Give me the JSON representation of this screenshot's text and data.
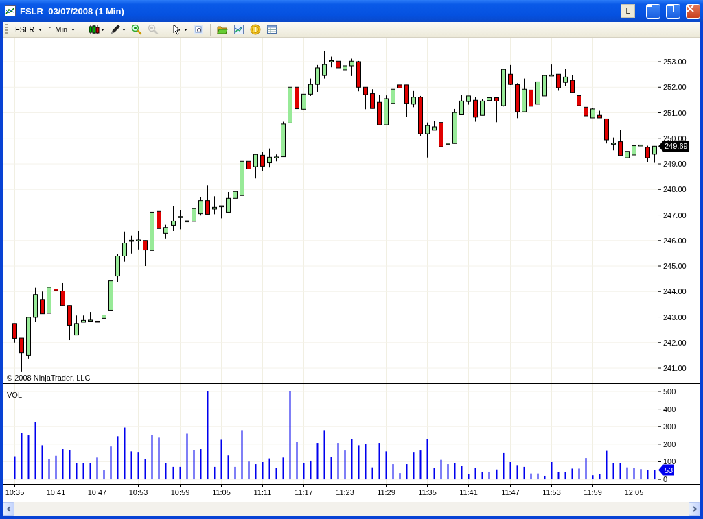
{
  "window": {
    "title": "FSLR  03/07/2008 (1 Min)",
    "link_button": "L"
  },
  "toolbar": {
    "instrument": "FSLR",
    "interval": "1 Min",
    "tool_groups": [
      [
        {
          "kind": "candles",
          "dropdown": true,
          "disabled": false
        },
        {
          "kind": "pencil",
          "dropdown": true,
          "disabled": false
        },
        {
          "kind": "zoom-in",
          "dropdown": false,
          "disabled": false
        },
        {
          "kind": "zoom-out",
          "dropdown": false,
          "disabled": true
        }
      ],
      [
        {
          "kind": "pointer",
          "dropdown": true,
          "disabled": false
        },
        {
          "kind": "properties",
          "dropdown": false,
          "disabled": false
        }
      ],
      [
        {
          "kind": "folder",
          "dropdown": false,
          "disabled": false
        },
        {
          "kind": "chart",
          "dropdown": false,
          "disabled": false
        },
        {
          "kind": "coin",
          "dropdown": false,
          "disabled": false
        },
        {
          "kind": "table",
          "dropdown": false,
          "disabled": false
        }
      ]
    ]
  },
  "price_panel": {
    "copyright": "© 2008 NinjaTrader, LLC",
    "chart_data": {
      "type": "candlestick",
      "grid": true,
      "ylim": [
        240.41,
        253.94
      ],
      "categories": [
        null,
        null,
        null,
        null,
        null,
        null,
        null,
        null,
        null,
        null,
        null,
        null,
        null,
        null,
        null,
        null,
        null,
        null,
        null,
        null,
        null,
        null,
        null,
        null,
        null,
        null,
        null,
        null,
        null,
        null,
        null,
        null,
        null,
        null,
        null,
        null,
        null,
        null,
        null,
        null,
        null,
        null,
        null,
        null,
        null,
        null,
        null,
        null,
        null,
        null,
        null,
        null,
        null,
        null,
        null,
        null,
        null,
        null,
        null,
        null,
        null,
        null,
        null,
        null,
        null,
        null,
        null,
        null,
        null,
        null,
        null,
        null,
        null,
        null,
        null,
        null,
        null,
        null,
        null,
        null,
        null,
        null,
        null,
        null,
        null,
        null,
        null,
        null,
        null,
        null,
        null,
        null,
        null,
        null
      ],
      "yticks": [
        {
          "value": 241,
          "label": "241.00"
        },
        {
          "value": 242,
          "label": "242.00"
        },
        {
          "value": 243,
          "label": "243.00"
        },
        {
          "value": 244,
          "label": "244.00"
        },
        {
          "value": 245,
          "label": "245.00"
        },
        {
          "value": 246,
          "label": "246.00"
        },
        {
          "value": 247,
          "label": "247.00"
        },
        {
          "value": 248,
          "label": "248.00"
        },
        {
          "value": 249,
          "label": "249.00"
        },
        {
          "value": 250,
          "label": "250.00"
        },
        {
          "value": 251,
          "label": "251.00"
        },
        {
          "value": 252,
          "label": "252.00"
        },
        {
          "value": 253,
          "label": "253.00"
        }
      ],
      "annotations": [
        "249.69"
      ],
      "ohlc": [
        [
          242.75,
          242.75,
          242.0,
          242.17
        ],
        [
          242.18,
          242.18,
          240.87,
          241.6
        ],
        [
          241.5,
          243.0,
          241.38,
          242.99
        ],
        [
          242.99,
          244.15,
          242.8,
          243.88
        ],
        [
          243.69,
          244.0,
          243.13,
          243.13
        ],
        [
          243.15,
          244.24,
          243.15,
          244.17
        ],
        [
          244.1,
          244.33,
          243.9,
          244.03
        ],
        [
          244.02,
          244.33,
          243.45,
          243.45
        ],
        [
          243.45,
          243.45,
          242.1,
          242.68
        ],
        [
          242.3,
          243.06,
          242.3,
          242.75
        ],
        [
          242.8,
          243.06,
          242.8,
          242.87
        ],
        [
          242.86,
          243.2,
          242.84,
          242.86
        ],
        [
          242.84,
          243.18,
          242.56,
          242.8
        ],
        [
          242.95,
          243.47,
          242.95,
          243.08
        ],
        [
          243.27,
          244.76,
          243.27,
          244.42
        ],
        [
          244.61,
          245.46,
          244.36,
          245.39
        ],
        [
          245.39,
          246.35,
          245.17,
          245.9
        ],
        [
          245.99,
          246.19,
          245.49,
          245.99
        ],
        [
          246.0,
          246.37,
          245.65,
          246.0
        ],
        [
          246.0,
          246.0,
          245.0,
          245.63
        ],
        [
          245.61,
          247.11,
          245.26,
          247.11
        ],
        [
          247.14,
          247.6,
          246.17,
          246.47
        ],
        [
          246.28,
          246.62,
          246.08,
          246.51
        ],
        [
          246.6,
          247.34,
          246.37,
          246.76
        ],
        [
          246.92,
          247.18,
          246.44,
          246.92
        ],
        [
          246.75,
          247.18,
          246.51,
          246.75
        ],
        [
          246.75,
          247.25,
          246.65,
          247.25
        ],
        [
          247.05,
          247.7,
          246.98,
          247.56
        ],
        [
          247.56,
          248.16,
          247.03,
          247.03
        ],
        [
          247.23,
          247.73,
          247.03,
          247.3
        ],
        [
          247.34,
          247.34,
          246.87,
          247.34
        ],
        [
          247.11,
          247.9,
          247.11,
          247.65
        ],
        [
          247.65,
          247.96,
          247.49,
          247.92
        ],
        [
          247.76,
          249.37,
          247.76,
          249.1
        ],
        [
          249.1,
          249.34,
          248.05,
          248.8
        ],
        [
          248.89,
          249.37,
          248.43,
          249.37
        ],
        [
          249.34,
          249.47,
          248.73,
          248.91
        ],
        [
          249.04,
          249.6,
          248.86,
          249.26
        ],
        [
          249.25,
          249.37,
          249.1,
          249.25
        ],
        [
          249.28,
          250.65,
          249.28,
          250.56
        ],
        [
          250.6,
          252.0,
          250.6,
          252.0
        ],
        [
          252.0,
          252.87,
          251.14,
          251.16
        ],
        [
          251.14,
          251.73,
          251.14,
          251.73
        ],
        [
          251.73,
          252.34,
          251.66,
          252.11
        ],
        [
          252.11,
          252.87,
          251.82,
          252.76
        ],
        [
          252.46,
          253.43,
          252.34,
          252.89
        ],
        [
          253.02,
          253.2,
          252.78,
          253.02
        ],
        [
          253.02,
          253.18,
          252.49,
          252.76
        ],
        [
          252.68,
          253.02,
          252.68,
          252.84
        ],
        [
          252.84,
          253.12,
          252.44,
          253.02
        ],
        [
          253.0,
          253.03,
          251.84,
          252.0
        ],
        [
          252.0,
          252.0,
          251.14,
          251.71
        ],
        [
          251.75,
          251.92,
          251.17,
          251.17
        ],
        [
          251.41,
          251.71,
          250.53,
          250.53
        ],
        [
          250.53,
          251.68,
          250.53,
          251.55
        ],
        [
          251.37,
          252.11,
          251.22,
          251.92
        ],
        [
          252.09,
          252.16,
          251.89,
          251.97
        ],
        [
          252.09,
          252.09,
          250.85,
          251.37
        ],
        [
          251.34,
          251.85,
          251.22,
          251.61
        ],
        [
          251.61,
          251.66,
          250.1,
          250.18
        ],
        [
          250.18,
          250.62,
          249.25,
          250.5
        ],
        [
          250.32,
          250.67,
          250.32,
          250.45
        ],
        [
          250.62,
          250.67,
          249.64,
          249.67
        ],
        [
          249.79,
          250.13,
          249.7,
          249.79
        ],
        [
          249.8,
          251.15,
          249.8,
          251.01
        ],
        [
          250.92,
          251.71,
          250.92,
          251.46
        ],
        [
          251.44,
          251.66,
          251.32,
          251.66
        ],
        [
          251.49,
          251.62,
          250.65,
          250.83
        ],
        [
          250.9,
          251.53,
          250.9,
          251.46
        ],
        [
          251.48,
          251.66,
          251.08,
          251.59
        ],
        [
          251.59,
          251.59,
          250.63,
          251.46
        ],
        [
          251.28,
          252.7,
          251.25,
          252.7
        ],
        [
          252.51,
          252.87,
          252.09,
          252.11
        ],
        [
          252.1,
          252.16,
          250.79,
          251.04
        ],
        [
          251.04,
          252.34,
          251.04,
          251.92
        ],
        [
          251.89,
          251.92,
          251.26,
          251.26
        ],
        [
          251.34,
          252.21,
          251.34,
          252.21
        ],
        [
          251.66,
          252.46,
          251.66,
          252.46
        ],
        [
          252.46,
          252.89,
          252.46,
          252.46
        ],
        [
          252.51,
          252.51,
          251.86,
          251.98
        ],
        [
          252.19,
          252.71,
          252.04,
          252.4
        ],
        [
          252.27,
          252.48,
          251.8,
          251.8
        ],
        [
          251.67,
          251.8,
          251.28,
          251.28
        ],
        [
          251.22,
          251.32,
          250.34,
          250.88
        ],
        [
          250.8,
          251.19,
          250.8,
          251.15
        ],
        [
          250.9,
          251.08,
          250.8,
          250.8
        ],
        [
          250.76,
          250.76,
          249.8,
          249.94
        ],
        [
          249.79,
          250.03,
          249.53,
          249.79
        ],
        [
          249.87,
          250.34,
          249.33,
          249.33
        ],
        [
          249.24,
          249.62,
          249.08,
          249.49
        ],
        [
          249.35,
          250.06,
          249.35,
          249.71
        ],
        [
          249.72,
          250.83,
          249.72,
          249.72
        ],
        [
          249.65,
          249.71,
          249.08,
          249.24
        ],
        [
          249.38,
          249.7,
          249.04,
          249.69
        ]
      ]
    }
  },
  "volume_panel": {
    "chart_data": {
      "type": "bar",
      "title": "VOL",
      "grid": true,
      "ylim": [
        -27,
        543
      ],
      "categories": [
        "10:35",
        null,
        null,
        null,
        null,
        null,
        "10:41",
        null,
        null,
        null,
        null,
        null,
        "10:47",
        null,
        null,
        null,
        null,
        null,
        "10:53",
        null,
        null,
        null,
        null,
        null,
        "10:59",
        null,
        null,
        null,
        null,
        null,
        "11:05",
        null,
        null,
        null,
        null,
        null,
        "11:11",
        null,
        null,
        null,
        null,
        null,
        "11:17",
        null,
        null,
        null,
        null,
        null,
        "11:23",
        null,
        null,
        null,
        null,
        null,
        "11:29",
        null,
        null,
        null,
        null,
        null,
        "11:35",
        null,
        null,
        null,
        null,
        null,
        "11:41",
        null,
        null,
        null,
        null,
        null,
        "11:47",
        null,
        null,
        null,
        null,
        null,
        "11:53",
        null,
        null,
        null,
        null,
        null,
        "11:59",
        null,
        null,
        null,
        null,
        null,
        "12:05",
        null,
        null,
        null
      ],
      "yticks": [
        {
          "value": 0,
          "label": "0"
        },
        {
          "value": 100,
          "label": "100"
        },
        {
          "value": 200,
          "label": "200"
        },
        {
          "value": 300,
          "label": "300"
        },
        {
          "value": 400,
          "label": "400"
        },
        {
          "value": 500,
          "label": "500"
        }
      ],
      "annotations": [
        "53"
      ],
      "series": [
        {
          "color": "#0000ee",
          "values": [
            131,
            263,
            250,
            326,
            194,
            114,
            134,
            172,
            167,
            93,
            93,
            93,
            124,
            51,
            187,
            245,
            295,
            159,
            152,
            114,
            253,
            237,
            93,
            71,
            71,
            260,
            167,
            172,
            500,
            71,
            225,
            136,
            71,
            280,
            101,
            86,
            98,
            119,
            66,
            124,
            503,
            215,
            93,
            106,
            207,
            280,
            126,
            207,
            164,
            230,
            194,
            202,
            68,
            207,
            159,
            86,
            35,
            86,
            152,
            164,
            230,
            63,
            111,
            86,
            91,
            76,
            28,
            63,
            43,
            40,
            56,
            149,
            98,
            81,
            71,
            33,
            33,
            20,
            98,
            43,
            43,
            61,
            61,
            121,
            23,
            30,
            162,
            93,
            93,
            68,
            63,
            58,
            55,
            53
          ]
        }
      ]
    }
  }
}
